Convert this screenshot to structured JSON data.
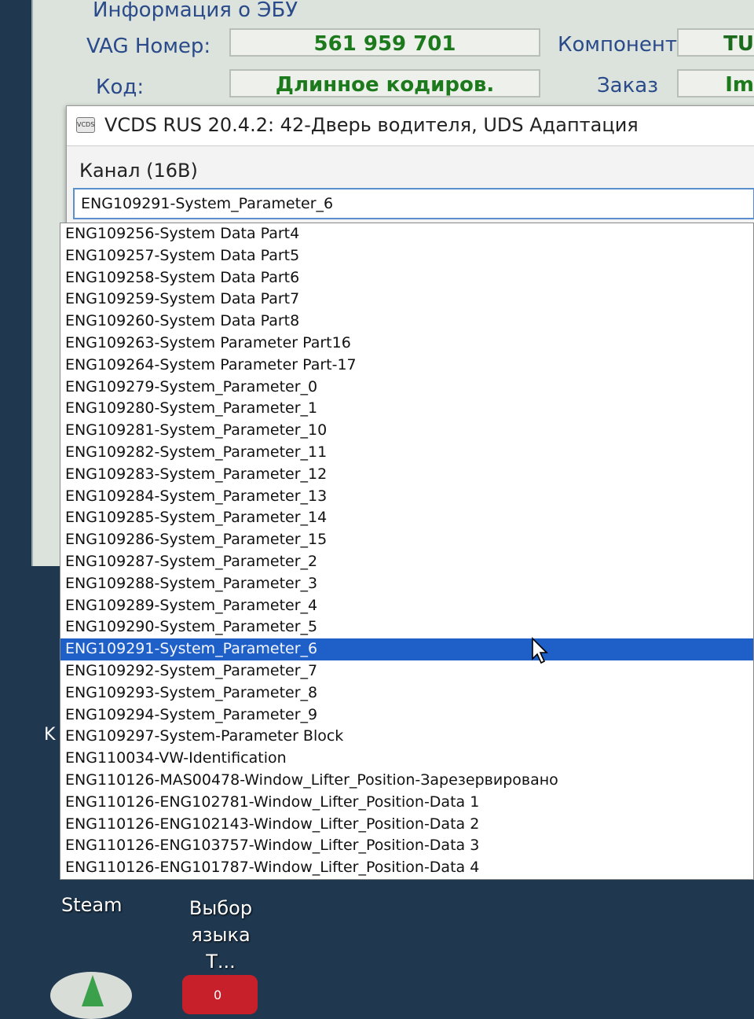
{
  "ecu_info": {
    "title": "Информация о ЭБУ",
    "vag_label": "VAG Номер:",
    "vag_value": "561 959 701",
    "component_label": "Компонент:",
    "component_value": "TU",
    "code_label": "Код:",
    "code_value": "Длинное кодиров.",
    "order_label": "Заказ",
    "order_value": "Im"
  },
  "dialog": {
    "title": "VCDS RUS 20.4.2: 42-Дверь водителя,  UDS Адаптация",
    "icon_text": "VCDS",
    "channel_label": "Канал (16B)",
    "channel_value": "ENG109291-System_Parameter_6"
  },
  "list": {
    "items": [
      "ENG109256-System Data Part4",
      "ENG109257-System Data Part5",
      "ENG109258-System Data Part6",
      "ENG109259-System Data Part7",
      "ENG109260-System Data Part8",
      "ENG109263-System Parameter Part16",
      "ENG109264-System Parameter Part-17",
      "ENG109279-System_Parameter_0",
      "ENG109280-System_Parameter_1",
      "ENG109281-System_Parameter_10",
      "ENG109282-System_Parameter_11",
      "ENG109283-System_Parameter_12",
      "ENG109284-System_Parameter_13",
      "ENG109285-System_Parameter_14",
      "ENG109286-System_Parameter_15",
      "ENG109287-System_Parameter_2",
      "ENG109288-System_Parameter_3",
      "ENG109289-System_Parameter_4",
      "ENG109290-System_Parameter_5",
      "ENG109291-System_Parameter_6",
      "ENG109292-System_Parameter_7",
      "ENG109293-System_Parameter_8",
      "ENG109294-System_Parameter_9",
      "ENG109297-System-Parameter Block",
      "ENG110034-VW-Identification",
      "ENG110126-MAS00478-Window_Lifter_Position-Зарезервировано",
      "ENG110126-ENG102781-Window_Lifter_Position-Data 1",
      "ENG110126-ENG102143-Window_Lifter_Position-Data 2",
      "ENG110126-ENG103757-Window_Lifter_Position-Data 3",
      "ENG110126-ENG101787-Window_Lifter_Position-Data 4"
    ],
    "selected_index": 19
  },
  "desktop": {
    "steam_label": "Steam",
    "lang_label_1": "Выбор",
    "lang_label_2": "языка Т...",
    "partial_k": "K",
    "badge_text": "0"
  },
  "colors": {
    "selection": "#1e5fc8",
    "field_text": "#1c7a1c",
    "label_text": "#2a4a8a"
  }
}
